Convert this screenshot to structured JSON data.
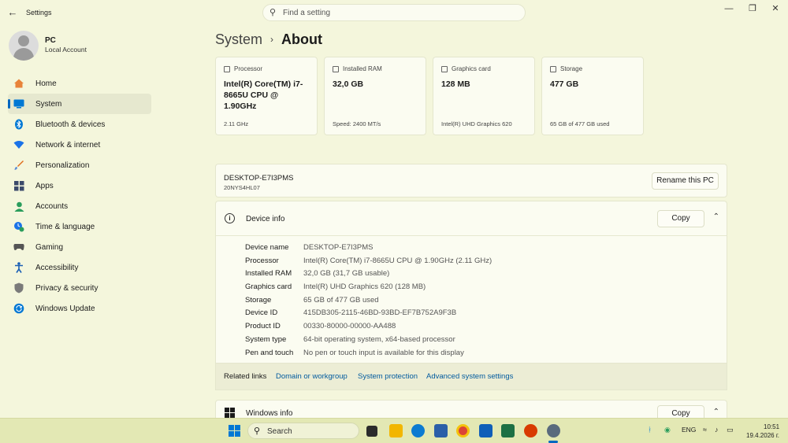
{
  "window": {
    "title": "Settings"
  },
  "search": {
    "placeholder": "Find a setting"
  },
  "profile": {
    "name": "PC",
    "account": "Local Account"
  },
  "sidebar": {
    "items": [
      {
        "label": "Home",
        "icon": "home-icon",
        "color": "#e8833a"
      },
      {
        "label": "System",
        "icon": "system-icon",
        "color": "#0078d4",
        "active": true
      },
      {
        "label": "Bluetooth & devices",
        "icon": "bluetooth-icon",
        "color": "#0078d4"
      },
      {
        "label": "Network & internet",
        "icon": "network-icon",
        "color": "#1a73e8"
      },
      {
        "label": "Personalization",
        "icon": "brush-icon",
        "color": "#e06c1a"
      },
      {
        "label": "Apps",
        "icon": "apps-icon",
        "color": "#3b4a6b"
      },
      {
        "label": "Accounts",
        "icon": "accounts-icon",
        "color": "#2a9d5c"
      },
      {
        "label": "Time & language",
        "icon": "time-language-icon",
        "color": "#1a73e8"
      },
      {
        "label": "Gaming",
        "icon": "gaming-icon",
        "color": "#555555"
      },
      {
        "label": "Accessibility",
        "icon": "accessibility-icon",
        "color": "#1a5fb4"
      },
      {
        "label": "Privacy & security",
        "icon": "shield-icon",
        "color": "#7a7a7a"
      },
      {
        "label": "Windows Update",
        "icon": "update-icon",
        "color": "#0078d4"
      }
    ]
  },
  "breadcrumb": {
    "parent": "System",
    "current": "About"
  },
  "spec_cards": [
    {
      "title": "Processor",
      "value": "Intel(R) Core(TM) i7-8665U CPU @ 1.90GHz",
      "sub": "2.11 GHz"
    },
    {
      "title": "Installed RAM",
      "value": "32,0 GB",
      "sub": "Speed: 2400 MT/s"
    },
    {
      "title": "Graphics card",
      "value": "128 MB",
      "sub": "Intel(R) UHD Graphics 620"
    },
    {
      "title": "Storage",
      "value": "477 GB",
      "sub": "65 GB of 477 GB used"
    }
  ],
  "pc": {
    "name": "DESKTOP-E7I3PMS",
    "model": "20NYS4HL07",
    "rename_label": "Rename this PC"
  },
  "device_info": {
    "title": "Device info",
    "copy_label": "Copy",
    "rows": [
      {
        "key": "Device name",
        "value": "DESKTOP-E7I3PMS"
      },
      {
        "key": "Processor",
        "value": "Intel(R) Core(TM) i7-8665U CPU @ 1.90GHz (2.11 GHz)"
      },
      {
        "key": "Installed RAM",
        "value": "32,0 GB (31,7 GB usable)"
      },
      {
        "key": "Graphics card",
        "value": "Intel(R) UHD Graphics 620 (128 MB)"
      },
      {
        "key": "Storage",
        "value": "65 GB of 477 GB used"
      },
      {
        "key": "Device ID",
        "value": "415DB305-2115-46BD-93BD-EF7B752A9F3B"
      },
      {
        "key": "Product ID",
        "value": "00330-80000-00000-AA488"
      },
      {
        "key": "System type",
        "value": "64-bit operating system, x64-based processor"
      },
      {
        "key": "Pen and touch",
        "value": "No pen or touch input is available for this display"
      }
    ]
  },
  "related": {
    "label": "Related links",
    "links": [
      "Domain or workgroup",
      "System protection",
      "Advanced system settings"
    ]
  },
  "windows_info": {
    "title": "Windows info",
    "copy_label": "Copy"
  },
  "taskbar": {
    "search_label": "Search",
    "apps": [
      {
        "name": "task-view-icon",
        "color": "#2b2b2b"
      },
      {
        "name": "file-explorer-icon",
        "color": "#f2b600"
      },
      {
        "name": "edge-icon",
        "color": "#0c7bd1"
      },
      {
        "name": "store-icon",
        "color": "#2b5fa8"
      },
      {
        "name": "chrome-icon",
        "color": "#db4437"
      },
      {
        "name": "outlook-icon",
        "color": "#0f5fb8"
      },
      {
        "name": "excel-icon",
        "color": "#1d7044"
      },
      {
        "name": "office-icon",
        "color": "#d83b01"
      },
      {
        "name": "settings-icon",
        "color": "#5a6b7d"
      }
    ],
    "language": "ENG",
    "time": "10:51",
    "date": "19.4.2026 г."
  }
}
